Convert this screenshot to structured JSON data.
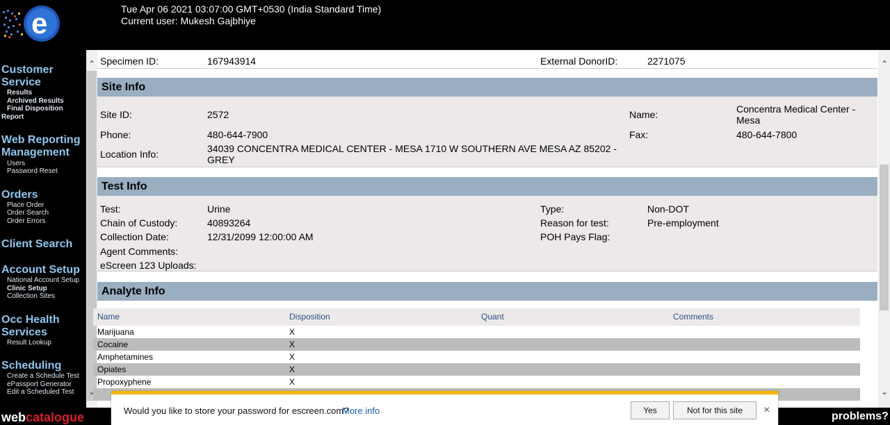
{
  "header": {
    "datetime": "Tue Apr 06 2021 03:07:00 GMT+0530 (India Standard Time)",
    "user": "Current user: Mukesh Gajbhiye"
  },
  "sidebar": {
    "customer_service": {
      "title1": "Customer",
      "title2": "Service",
      "links": [
        "Results",
        "Archived Results",
        "Final Disposition",
        "Report"
      ]
    },
    "web_reporting": {
      "title1": "Web Reporting",
      "title2": "Management",
      "links": [
        "Users",
        "Password Reset"
      ]
    },
    "orders": {
      "title": "Orders",
      "links": [
        "Place Order",
        "Order Search",
        "Order Errors"
      ]
    },
    "client_search": {
      "title": "Client Search"
    },
    "account_setup": {
      "title": "Account Setup",
      "links": [
        "National Account Setup",
        "Clinic Setup",
        "Collection Sites"
      ]
    },
    "occ_health": {
      "title1": "Occ Health",
      "title2": "Services",
      "links": [
        "Result Lookup"
      ]
    },
    "scheduling": {
      "title": "Scheduling",
      "links": [
        "Create a Schedule Test",
        "ePassport Generator",
        "Edit a Scheduled Test"
      ]
    }
  },
  "footer": {
    "web": "web",
    "catalogue": "catalogue",
    "problems": "problems?"
  },
  "specimen": {
    "id_label": "Specimen ID:",
    "id_value": "167943914",
    "donor_label": "External DonorID:",
    "donor_value": "2271075"
  },
  "site_info": {
    "title": "Site Info",
    "site_id_label": "Site ID:",
    "site_id_value": "2572",
    "name_label": "Name:",
    "name_value1": "Concentra Medical Center -",
    "name_value2": "Mesa",
    "phone_label": "Phone:",
    "phone_value": "480-644-7900",
    "fax_label": "Fax:",
    "fax_value": "480-644-7800",
    "location_label": "Location Info:",
    "location_value1": "34039 CONCENTRA MEDICAL CENTER - MESA 1710 W SOUTHERN AVE MESA AZ 85202 -",
    "location_value2": "GREY"
  },
  "test_info": {
    "title": "Test Info",
    "test_label": "Test:",
    "test_value": "Urine",
    "type_label": "Type:",
    "type_value": "Non-DOT",
    "coc_label": "Chain of Custody:",
    "coc_value": "40893264",
    "reason_label": "Reason for test:",
    "reason_value": "Pre-employment",
    "date_label": "Collection Date:",
    "date_value": "12/31/2099 12:00:00 AM",
    "poh_label": "POH Pays Flag:",
    "agent_label": "Agent Comments:",
    "uploads_label": "eScreen 123 Uploads:"
  },
  "analyte_info": {
    "title": "Analyte Info",
    "columns": [
      "Name",
      "Disposition",
      "Quant",
      "Comments"
    ],
    "rows": [
      {
        "name": "Marijuana",
        "disposition": "X"
      },
      {
        "name": "Cocaine",
        "disposition": "X"
      },
      {
        "name": "Amphetamines",
        "disposition": "X"
      },
      {
        "name": "Opiates",
        "disposition": "X"
      },
      {
        "name": "Propoxyphene",
        "disposition": "X"
      }
    ]
  },
  "password_bar": {
    "message": "Would you like to store your password for escreen.com?",
    "more_info": "More info",
    "yes": "Yes",
    "not_for_site": "Not for this site",
    "close": "×"
  },
  "icons": {
    "scroll_up": "chevron-up-icon",
    "scroll_down": "chevron-down-icon",
    "close": "close-icon"
  },
  "colors": {
    "panel_header": "#9aaec2",
    "panel_body": "#ece9e8",
    "sidebar_title": "#8fc6ee",
    "alt_row": "#bcbcbc",
    "warning_bar": "#f4b400"
  }
}
